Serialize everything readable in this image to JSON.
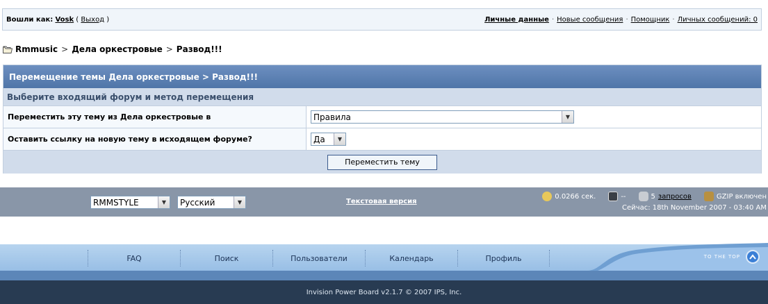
{
  "userbar": {
    "logged_prefix": "Вошли как:",
    "username": "Vosk",
    "logout_open": "(",
    "logout_label": "Выход",
    "logout_close": ")",
    "links": [
      {
        "label": "Личные данные"
      },
      {
        "label": "Новые сообщения"
      },
      {
        "label": "Помощник"
      },
      {
        "label": "Личных сообщений: 0"
      }
    ],
    "separator": "·"
  },
  "breadcrumb": {
    "items": [
      "Rmmusic",
      "Дела оркестровые",
      "Развод!!!"
    ],
    "separator": ">"
  },
  "move_form": {
    "title": "Перемещение темы Дела оркестровые > Развод!!!",
    "subtitle": "Выберите входящий форум и метод перемещения",
    "destination_label": "Переместить эту тему из Дела оркестровые в",
    "destination_value": "Правила",
    "leave_link_label": "Оставить ссылку на новую тему в исходящем форуме?",
    "leave_link_value": "Да",
    "submit_label": "Переместить тему"
  },
  "style_bar": {
    "skin_value": "RMMSTYLE",
    "language_value": "Русский",
    "lofi_label": "Текстовая версия",
    "exec_time": "0.0266 сек.",
    "load": "--",
    "queries_count": "5",
    "queries_label": "запросов",
    "gzip": "GZIP включен",
    "server_time": "Сейчас: 18th November 2007 - 03:40 AM"
  },
  "footer_nav": {
    "links": [
      "FAQ",
      "Поиск",
      "Пользователи",
      "Календарь",
      "Профиль"
    ],
    "to_top": "TO THE TOP"
  },
  "copyright": "Invision Power Board v2.1.7 © 2007  IPS, Inc.",
  "colors": {
    "title_bar": "#4f75a8",
    "subtitle_bar": "#d1dceb",
    "border": "#c2cfdf",
    "style_bar": "#8996a8",
    "footer_dark": "#283b52"
  }
}
